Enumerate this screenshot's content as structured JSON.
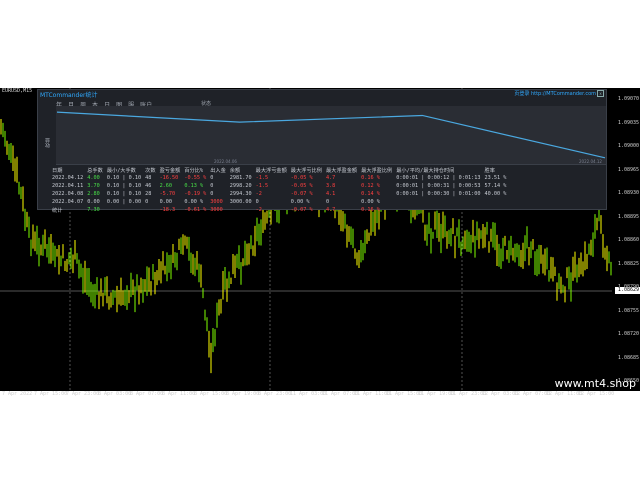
{
  "chart": {
    "symbol": "EURUSD,M15",
    "price_ticks": [
      "1.09070",
      "1.09035",
      "1.09000",
      "1.08965",
      "1.08930",
      "1.08895",
      "1.08860",
      "1.08825",
      "1.08790",
      "1.08755",
      "1.08720",
      "1.08685",
      "1.08650"
    ],
    "current_price": "1.08629",
    "time_ticks": [
      "7 Apr 2022",
      "7 Apr 15:00",
      "7 Apr 23:00",
      "8 Apr 03:00",
      "8 Apr 07:00",
      "8 Apr 11:00",
      "8 Apr 15:00",
      "8 Apr 19:00",
      "8 Apr 23:00",
      "11 Apr 03:00",
      "11 Apr 07:00",
      "11 Apr 11:00",
      "11 Apr 15:00",
      "11 Apr 19:00",
      "11 Apr 23:00",
      "12 Apr 03:00",
      "12 Apr 07:00",
      "12 Apr 11:00",
      "12 Apr 15:00"
    ],
    "watermark": "www.mt4.shop",
    "colors": {
      "bull": "#7fff00",
      "bear": "#ffff00",
      "background": "#000000",
      "grid": "#ffffff"
    }
  },
  "panel": {
    "title": "MTCommander统计",
    "link": "页登录 http://MTCommander.com",
    "close": "x",
    "tabs": [
      "年",
      "月",
      "周",
      "本",
      "日",
      "图",
      "服",
      "账户"
    ],
    "status": "状态",
    "y_label": "收益",
    "curve_dates": [
      "2022.04.06",
      "2022.04.12"
    ],
    "headers": [
      "日期",
      "总手数",
      "最小/大手数",
      "次数",
      "盈亏金额",
      "百分比%",
      "出入金",
      "余额",
      "最大浮亏金额",
      "最大浮亏比例",
      "最大浮盈金额",
      "最大浮盈比例",
      "最小/平均/最大持仓时间",
      "胜率"
    ],
    "rows": [
      [
        "2022.04.12",
        "4.00",
        "0.10 | 0.10",
        "48",
        "-16.50",
        "-0.55 %",
        "0",
        "2981.70",
        "-1.5",
        "-0.05 %",
        "4.7",
        "0.16 %",
        "0:00:01 | 0:00:12 | 0:01:13",
        "23.51 %"
      ],
      [
        "2022.04.11",
        "3.70",
        "0.10 | 0.10",
        "46",
        "2.60",
        "0.13 %",
        "0",
        "2998.20",
        "-1.5",
        "-0.05 %",
        "3.8",
        "0.12 %",
        "0:00:01 | 0:00:31 | 0:00:53",
        "57.14 %"
      ],
      [
        "2022.04.08",
        "2.80",
        "0.10 | 0.10",
        "28",
        "-5.70",
        "-0.19 %",
        "0",
        "2994.30",
        "-2",
        "-0.07 %",
        "4.1",
        "0.14 %",
        "0:00:01 | 0:00:30 | 0:01:00",
        "40.00 %"
      ],
      [
        "2022.04.07",
        "0.00",
        "0.00 | 0.00",
        "0",
        "0.00",
        "0.00 %",
        "3000",
        "3000.00",
        "0",
        "0.00 %",
        "0",
        "0.00 %",
        "",
        ""
      ],
      [
        "统计",
        "7.30",
        "",
        "",
        "-18.3",
        "-0.61 %",
        "3000",
        "",
        "-2",
        "-0.07 %",
        "4.7",
        "0.16 %",
        "",
        ""
      ]
    ],
    "curve": [
      0,
      -12,
      -4,
      -55
    ]
  }
}
